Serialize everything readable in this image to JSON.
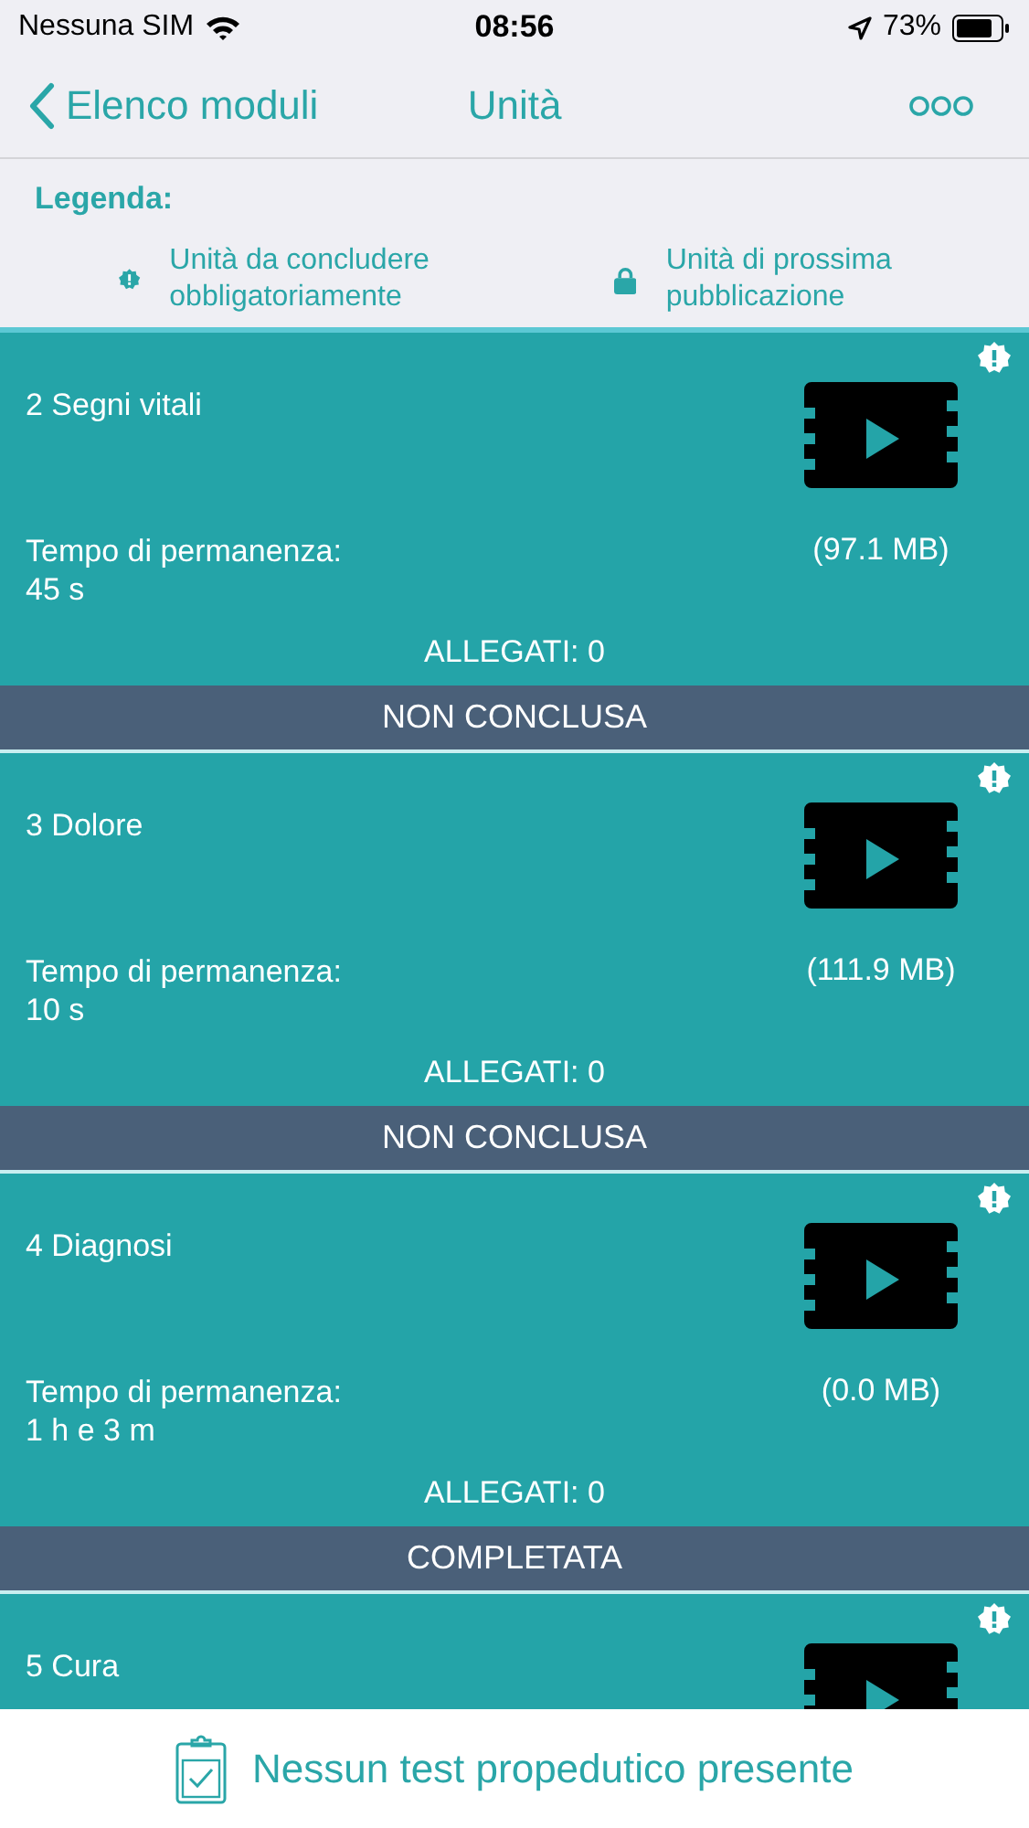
{
  "status_bar": {
    "carrier": "Nessuna SIM",
    "time": "08:56",
    "battery": "73%"
  },
  "nav": {
    "back": "Elenco moduli",
    "title": "Unità"
  },
  "legend": {
    "title": "Legenda:",
    "items": [
      {
        "kind": "mandatory",
        "label": "Unità da concludere obbligatoriamente"
      },
      {
        "kind": "locked",
        "label": "Unità di prossima pubblicazione"
      }
    ]
  },
  "units": [
    {
      "title": "2 Segni vitali",
      "mandatory": true,
      "time_label": "Tempo di permanenza:",
      "time": "45 s",
      "size": "(97.1 MB)",
      "attachments": "ALLEGATI: 0",
      "status": "NON CONCLUSA"
    },
    {
      "title": "3 Dolore",
      "mandatory": true,
      "time_label": "Tempo di permanenza:",
      "time": "10 s",
      "size": "(111.9 MB)",
      "attachments": "ALLEGATI: 0",
      "status": "NON CONCLUSA"
    },
    {
      "title": "4 Diagnosi",
      "mandatory": true,
      "time_label": "Tempo di permanenza:",
      "time": "1 h e 3 m",
      "size": "(0.0 MB)",
      "attachments": "ALLEGATI: 0",
      "status": "COMPLETATA"
    },
    {
      "title": "5 Cura",
      "mandatory": true
    }
  ],
  "footer": {
    "label": "Nessun test propedutico presente"
  }
}
